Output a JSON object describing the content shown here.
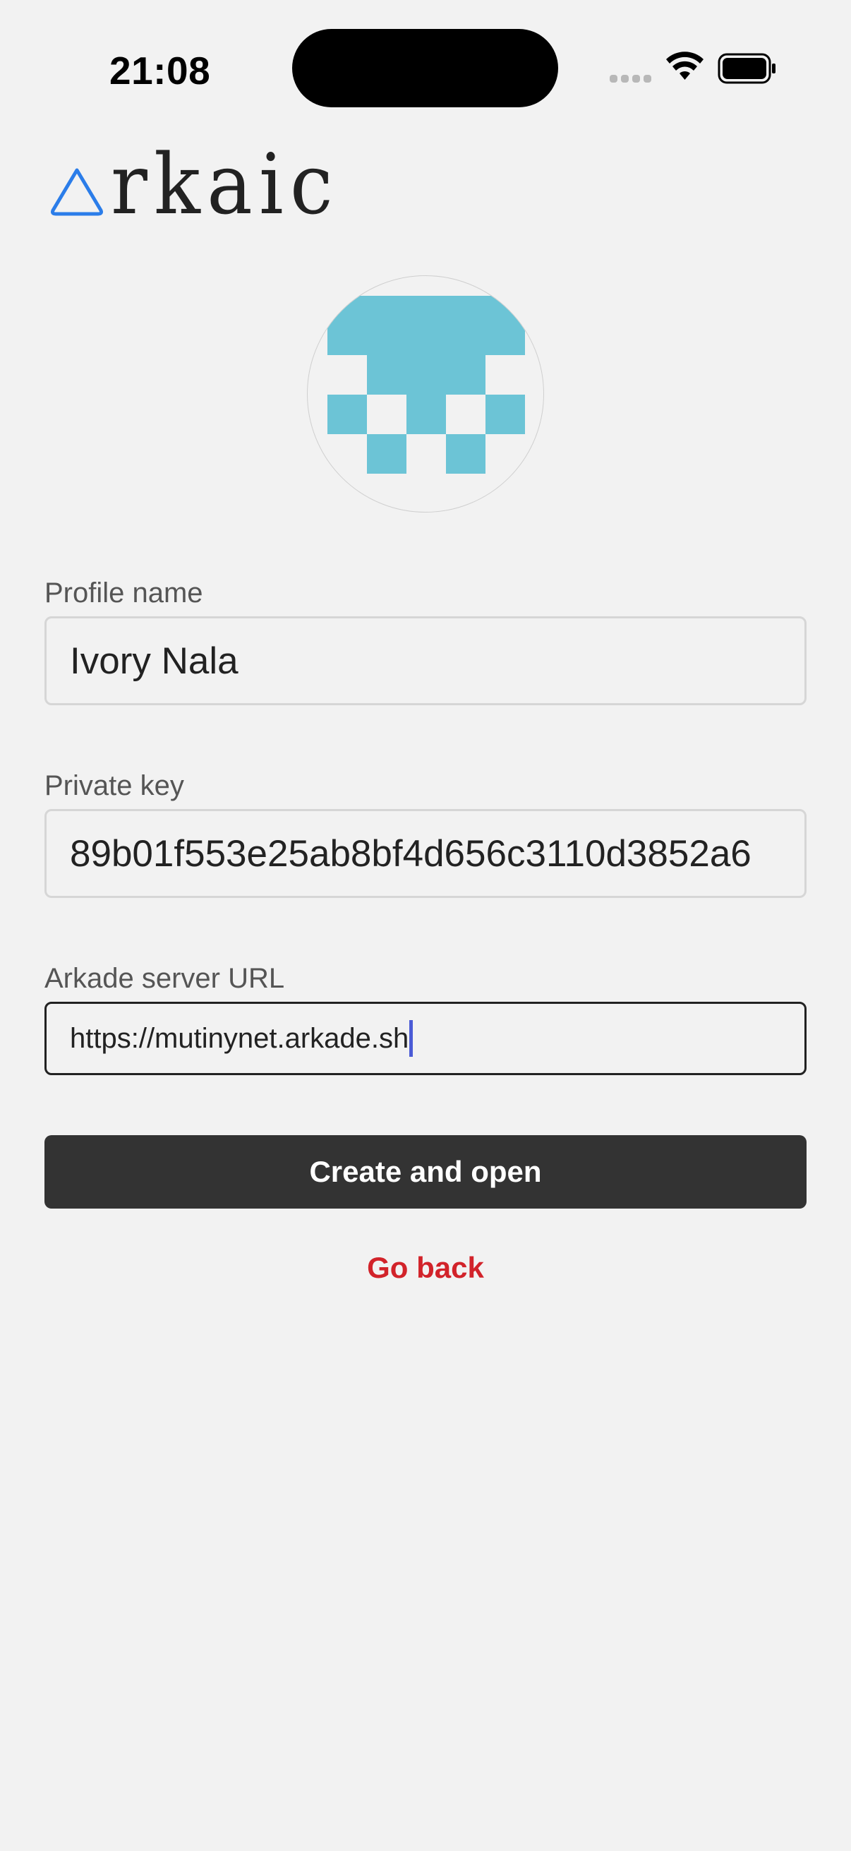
{
  "status_bar": {
    "time": "21:08"
  },
  "logo": {
    "text": "rkaic",
    "mark_color": "#2b7de9"
  },
  "avatar": {
    "color": "#6cc4d6",
    "alt": "profile-identicon"
  },
  "form": {
    "profile_name": {
      "label": "Profile name",
      "value": "Ivory Nala"
    },
    "private_key": {
      "label": "Private key",
      "value": "89b01f553e25ab8bf4d656c3110d3852a6"
    },
    "server_url": {
      "label": "Arkade server URL",
      "value": "https://mutinynet.arkade.sh"
    }
  },
  "actions": {
    "create_label": "Create and open",
    "back_label": "Go back"
  },
  "colors": {
    "background": "#f2f2f2",
    "primary_button": "#333333",
    "back_link": "#d2232a",
    "caret": "#4b5bd6"
  }
}
